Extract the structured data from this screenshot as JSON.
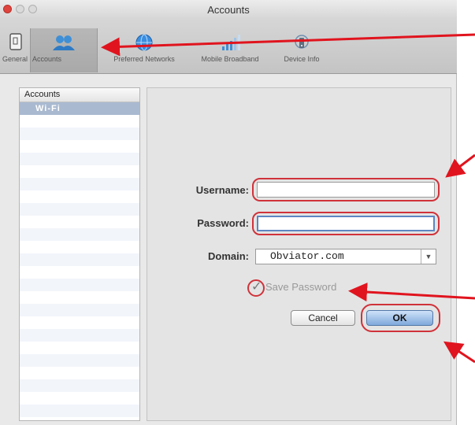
{
  "window": {
    "title": "Accounts"
  },
  "toolbar": {
    "items": [
      {
        "label": "General",
        "icon": "phone-icon"
      },
      {
        "label": "Accounts",
        "icon": "users-icon"
      },
      {
        "label": "Preferred Networks",
        "icon": "globe-icon"
      },
      {
        "label": "Mobile Broadband",
        "icon": "signal-icon"
      },
      {
        "label": "Device Info",
        "icon": "device-icon"
      }
    ],
    "selected": "Accounts"
  },
  "sidebar": {
    "header": "Accounts",
    "items": [
      {
        "label": "Wi-Fi"
      }
    ]
  },
  "form": {
    "username_label": "Username:",
    "username_value": "",
    "password_label": "Password:",
    "password_value": "",
    "domain_label": "Domain:",
    "domain_value": "Obviator.com",
    "save_password_label": "Save Password",
    "save_password_checked": true,
    "cancel_label": "Cancel",
    "ok_label": "OK"
  },
  "annotations": {
    "arrow_color": "#e0141e",
    "highlight_color": "#d0323a"
  }
}
